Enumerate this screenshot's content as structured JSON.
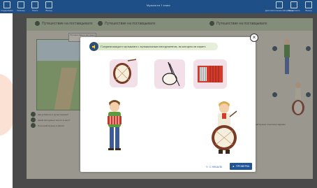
{
  "app": {
    "title": "Музыка из 1 класс"
  },
  "toolbar": {
    "items": [
      {
        "label": "Содержание"
      },
      {
        "label": "Помощь"
      },
      {
        "label": "Поиск"
      },
      {
        "label": "Выход"
      }
    ],
    "right_items": [
      {
        "label": "Дополнительные материалы"
      },
      {
        "label": "Продолжить"
      },
      {
        "label": "Выход"
      }
    ]
  },
  "lesson": {
    "tasks": [
      {
        "label": "Путешествие на поставцывало"
      },
      {
        "label": "Путешествие на поставцывало"
      },
      {
        "label": "Путешествие на поставцывало"
      }
    ],
    "scene_note": "Путешествие в лес (снег)",
    "left_instructions": [
      "Как добраться к ручью музыки?",
      "Какой инструмент звучит в лесу?",
      "Послушай музыку в записи"
    ],
    "right_instruction": "Послушай музыку и выполни задание"
  },
  "modal": {
    "instruction": "Соедини каждого музыканта с музыкальным инструментом, на котором он играет.",
    "items": [
      {
        "name": "drum"
      },
      {
        "name": "balalaika"
      },
      {
        "name": "accordion"
      },
      {
        "name": "boy-with-accordion"
      },
      {
        "name": "boy-with-drum"
      }
    ],
    "restart_label": "С НАЧАЛА",
    "check_label": "ПРОВЕРКА"
  },
  "colors": {
    "topbar": "#1e4f86",
    "lesson_bg": "#dcd9c6",
    "check_button": "#1f5596",
    "instruction_bar": "#d7e7c3"
  }
}
